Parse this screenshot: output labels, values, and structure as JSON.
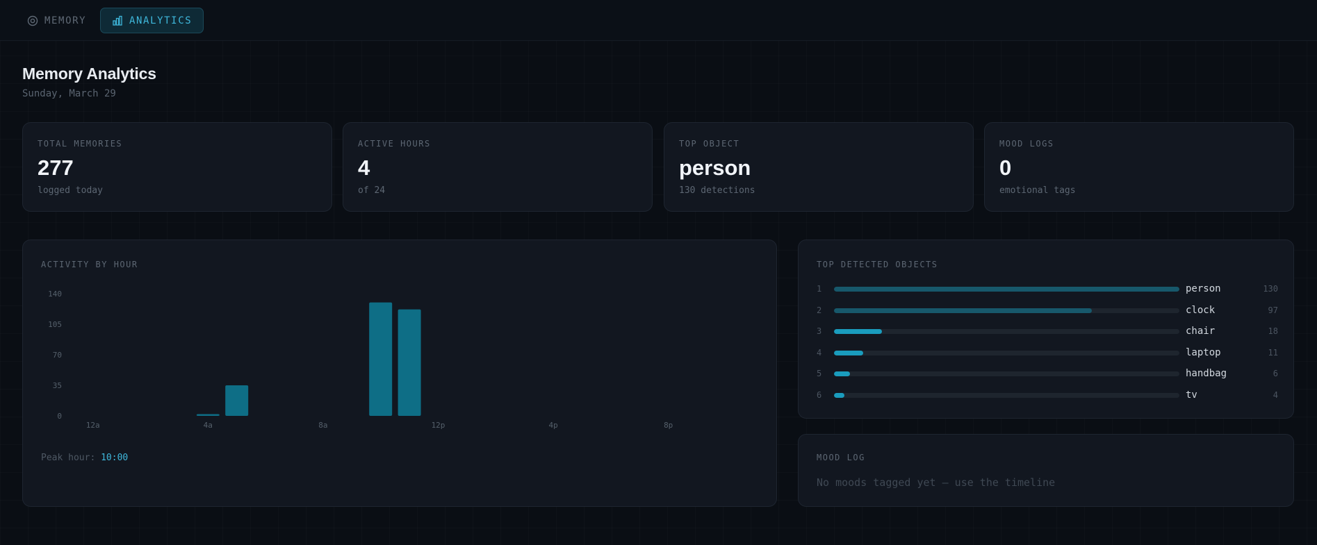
{
  "nav": {
    "tabs": [
      {
        "label": "MEMORY",
        "icon": "target-icon",
        "active": false
      },
      {
        "label": "ANALYTICS",
        "icon": "bar-chart-icon",
        "active": true
      }
    ]
  },
  "header": {
    "title": "Memory Analytics",
    "date": "Sunday, March 29"
  },
  "stats": [
    {
      "label": "TOTAL MEMORIES",
      "value": "277",
      "sub": "logged today"
    },
    {
      "label": "ACTIVE HOURS",
      "value": "4",
      "sub": "of 24"
    },
    {
      "label": "TOP OBJECT",
      "value": "person",
      "sub": "130 detections"
    },
    {
      "label": "MOOD LOGS",
      "value": "0",
      "sub": "emotional tags"
    }
  ],
  "activity": {
    "label": "ACTIVITY BY HOUR",
    "peak_label": "Peak hour:",
    "peak_value": "10:00"
  },
  "chart_data": {
    "type": "bar",
    "title": "ACTIVITY BY HOUR",
    "x": [
      0,
      1,
      2,
      3,
      4,
      5,
      6,
      7,
      8,
      9,
      10,
      11,
      12,
      13,
      14,
      15,
      16,
      17,
      18,
      19,
      20,
      21,
      22,
      23
    ],
    "values": [
      0,
      0,
      0,
      0,
      2,
      35,
      0,
      0,
      0,
      0,
      130,
      122,
      0,
      0,
      0,
      0,
      0,
      0,
      0,
      0,
      0,
      0,
      0,
      0
    ],
    "x_tick_labels": [
      {
        "x": 0,
        "label": "12a"
      },
      {
        "x": 4,
        "label": "4a"
      },
      {
        "x": 8,
        "label": "8a"
      },
      {
        "x": 12,
        "label": "12p"
      },
      {
        "x": 16,
        "label": "4p"
      },
      {
        "x": 20,
        "label": "8p"
      }
    ],
    "y_ticks": [
      0,
      35,
      70,
      105,
      140
    ],
    "ylim": [
      0,
      140
    ],
    "grid": false,
    "bar_color": "#0e6e86"
  },
  "top_objects": {
    "label": "TOP DETECTED OBJECTS",
    "items": [
      {
        "rank": "1",
        "name": "person",
        "count": 130,
        "color": "#17586b"
      },
      {
        "rank": "2",
        "name": "clock",
        "count": 97,
        "color": "#17586b"
      },
      {
        "rank": "3",
        "name": "chair",
        "count": 18,
        "color": "#1a9cbd"
      },
      {
        "rank": "4",
        "name": "laptop",
        "count": 11,
        "color": "#1a9cbd"
      },
      {
        "rank": "5",
        "name": "handbag",
        "count": 6,
        "color": "#1a9cbd"
      },
      {
        "rank": "6",
        "name": "tv",
        "count": 4,
        "color": "#1a9cbd"
      }
    ]
  },
  "mood": {
    "label": "MOOD LOG",
    "empty_text": "No moods tagged yet — use the timeline"
  },
  "colors": {
    "accent": "#3fb8dc",
    "bar": "#0e6e86",
    "background": "#0a0e14",
    "card": "#121720"
  }
}
